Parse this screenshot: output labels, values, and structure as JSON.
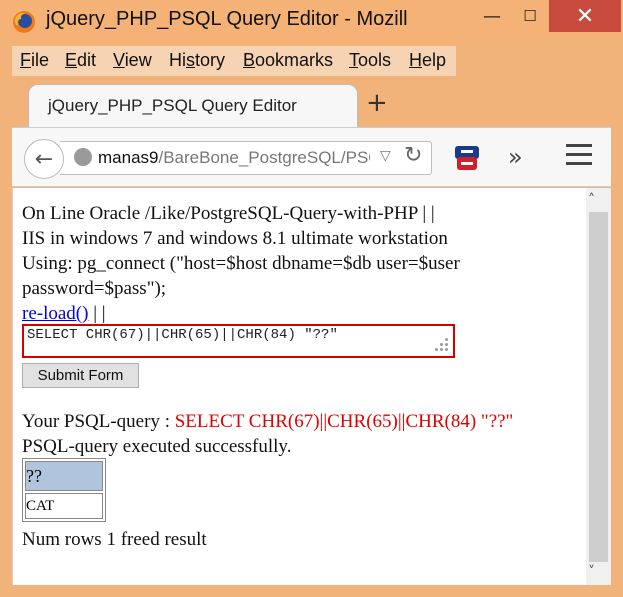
{
  "window": {
    "title": "jQuery_PHP_PSQL Query Editor - Mozill",
    "minimize": "—",
    "maximize": "☐",
    "close": "✕"
  },
  "menu": [
    {
      "ul": "F",
      "rest": "ile"
    },
    {
      "ul": "E",
      "rest": "dit"
    },
    {
      "ul": "V",
      "rest": "iew"
    },
    {
      "pre": "Hi",
      "ul": "s",
      "rest": "tory"
    },
    {
      "ul": "B",
      "rest": "ookmarks"
    },
    {
      "ul": "T",
      "rest": "ools"
    },
    {
      "ul": "H",
      "rest": "elp"
    }
  ],
  "tab": {
    "label": "jQuery_PHP_PSQL Query Editor",
    "new_tab": "+"
  },
  "nav": {
    "back": "←",
    "url_host": "manas9",
    "url_path": "/BareBone_PostgreSQL/PSQL",
    "dropdown": "▽",
    "reload": "↻",
    "overflow": "»"
  },
  "page": {
    "line1": "On Line Oracle /Like/PostgreSQL-Query-with-PHP | |",
    "line2": "IIS in windows 7 and windows 8.1 ultimate workstation",
    "line3": "Using: pg_connect (\"host=$host dbname=$db user=$user",
    "line4": "password=$pass\");",
    "reload_link": "re-load()",
    "reload_after": "| |",
    "query_value": "SELECT CHR(67)||CHR(65)||CHR(84) \"??\"",
    "submit_label": "Submit Form",
    "query_label": "Your PSQL-query : ",
    "query_echo": "SELECT CHR(67)||CHR(65)||CHR(84) \"??\"",
    "status": "PSQL-query executed successfully.",
    "table": {
      "header": "??",
      "cell": "CAT"
    },
    "rows_text": "Num rows 1 freed result"
  },
  "scroll": {
    "up": "˄",
    "down": "˅"
  },
  "colors": {
    "chrome": "#f2b37a",
    "close_btn": "#c74a3d",
    "query_border": "#d40000",
    "query_echo": "#e00000",
    "table_header": "#b0c4de",
    "link": "#0000ee"
  }
}
